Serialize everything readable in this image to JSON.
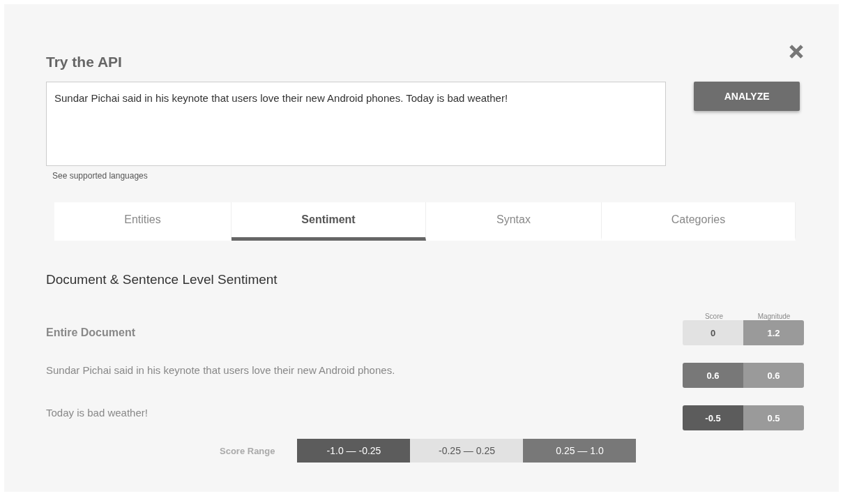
{
  "title": "Try the API",
  "input": {
    "value": "Sundar Pichai said in his keynote that users love their new Android phones. Today is bad weather!"
  },
  "analyze_button": "ANALYZE",
  "languages_link": "See supported languages",
  "tabs": [
    {
      "label": "Entities",
      "selected": false
    },
    {
      "label": "Sentiment",
      "selected": true
    },
    {
      "label": "Syntax",
      "selected": false
    },
    {
      "label": "Categories",
      "selected": false
    }
  ],
  "section_title": "Document & Sentence Level Sentiment",
  "columns": [
    "Score",
    "Magnitude"
  ],
  "rows": [
    {
      "kind": "document",
      "text": "Entire Document",
      "score": {
        "value": "0",
        "color": "#e2e2e2"
      },
      "magnitude": "1.2"
    },
    {
      "kind": "sentence",
      "text": "Sundar Pichai said in his keynote that users love their new Android phones.",
      "score": {
        "value": "0.6",
        "color": "#787878"
      },
      "magnitude": "0.6"
    },
    {
      "kind": "sentence",
      "text": "Today is bad weather!",
      "score": {
        "value": "-0.5",
        "color": "#5c5c5c"
      },
      "magnitude": "0.5"
    }
  ],
  "score_range": {
    "label": "Score Range",
    "segments": [
      {
        "text": "-1.0 — -0.25",
        "color": "#5c5c5c"
      },
      {
        "text": "-0.25 — 0.25",
        "color": "#e2e2e2"
      },
      {
        "text": "0.25 — 1.0",
        "color": "#787878"
      }
    ]
  }
}
